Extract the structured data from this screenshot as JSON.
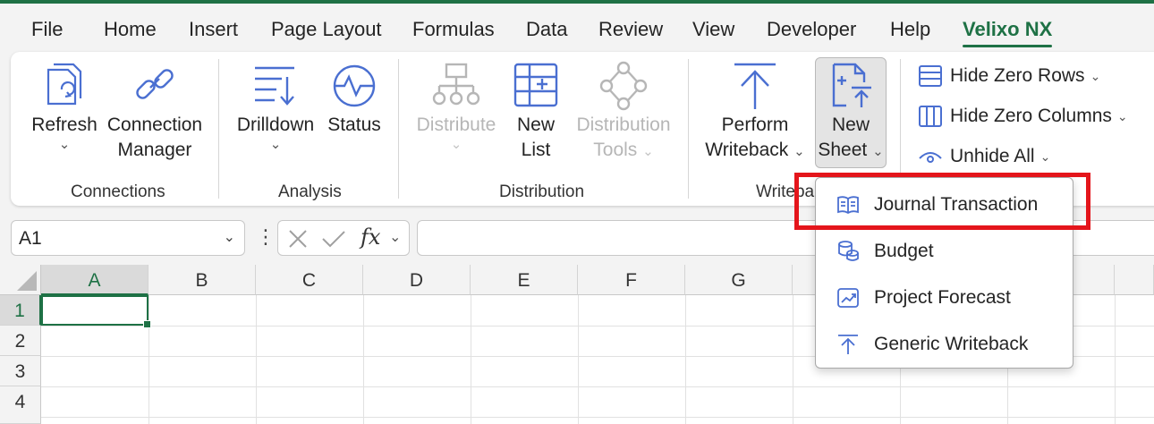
{
  "menu": {
    "items": [
      "File",
      "Home",
      "Insert",
      "Page Layout",
      "Formulas",
      "Data",
      "Review",
      "View",
      "Developer",
      "Help"
    ],
    "active": "Velixo NX"
  },
  "ribbon": {
    "connections": {
      "refresh": "Refresh",
      "connection_l1": "Connection",
      "connection_l2": "Manager",
      "label": "Connections"
    },
    "analysis": {
      "drilldown": "Drilldown",
      "status": "Status",
      "label": "Analysis"
    },
    "distribution": {
      "distribute": "Distribute",
      "newlist_l1": "New",
      "newlist_l2": "List",
      "tools_l1": "Distribution",
      "tools_l2": "Tools",
      "label": "Distribution"
    },
    "writeback": {
      "perform_l1": "Perform",
      "perform_l2": "Writeback",
      "newsheet_l1": "New",
      "newsheet_l2": "Sheet",
      "label": "Writeba"
    },
    "side": {
      "hide_zero_rows": "Hide Zero Rows",
      "hide_zero_columns": "Hide Zero Columns",
      "unhide_all": "Unhide All"
    }
  },
  "formula_bar": {
    "name_box": "A1",
    "fx": "fx",
    "content": ""
  },
  "grid": {
    "columns": [
      "A",
      "B",
      "C",
      "D",
      "E",
      "F",
      "G"
    ],
    "rows": [
      "1",
      "2",
      "3",
      "4"
    ]
  },
  "new_sheet_menu": {
    "items": [
      "Journal Transaction",
      "Budget",
      "Project Forecast",
      "Generic Writeback"
    ],
    "highlighted": "Journal Transaction"
  },
  "colors": {
    "accent": "#1e7145",
    "icon_blue": "#4a6fd1",
    "highlight": "#e4151b"
  }
}
